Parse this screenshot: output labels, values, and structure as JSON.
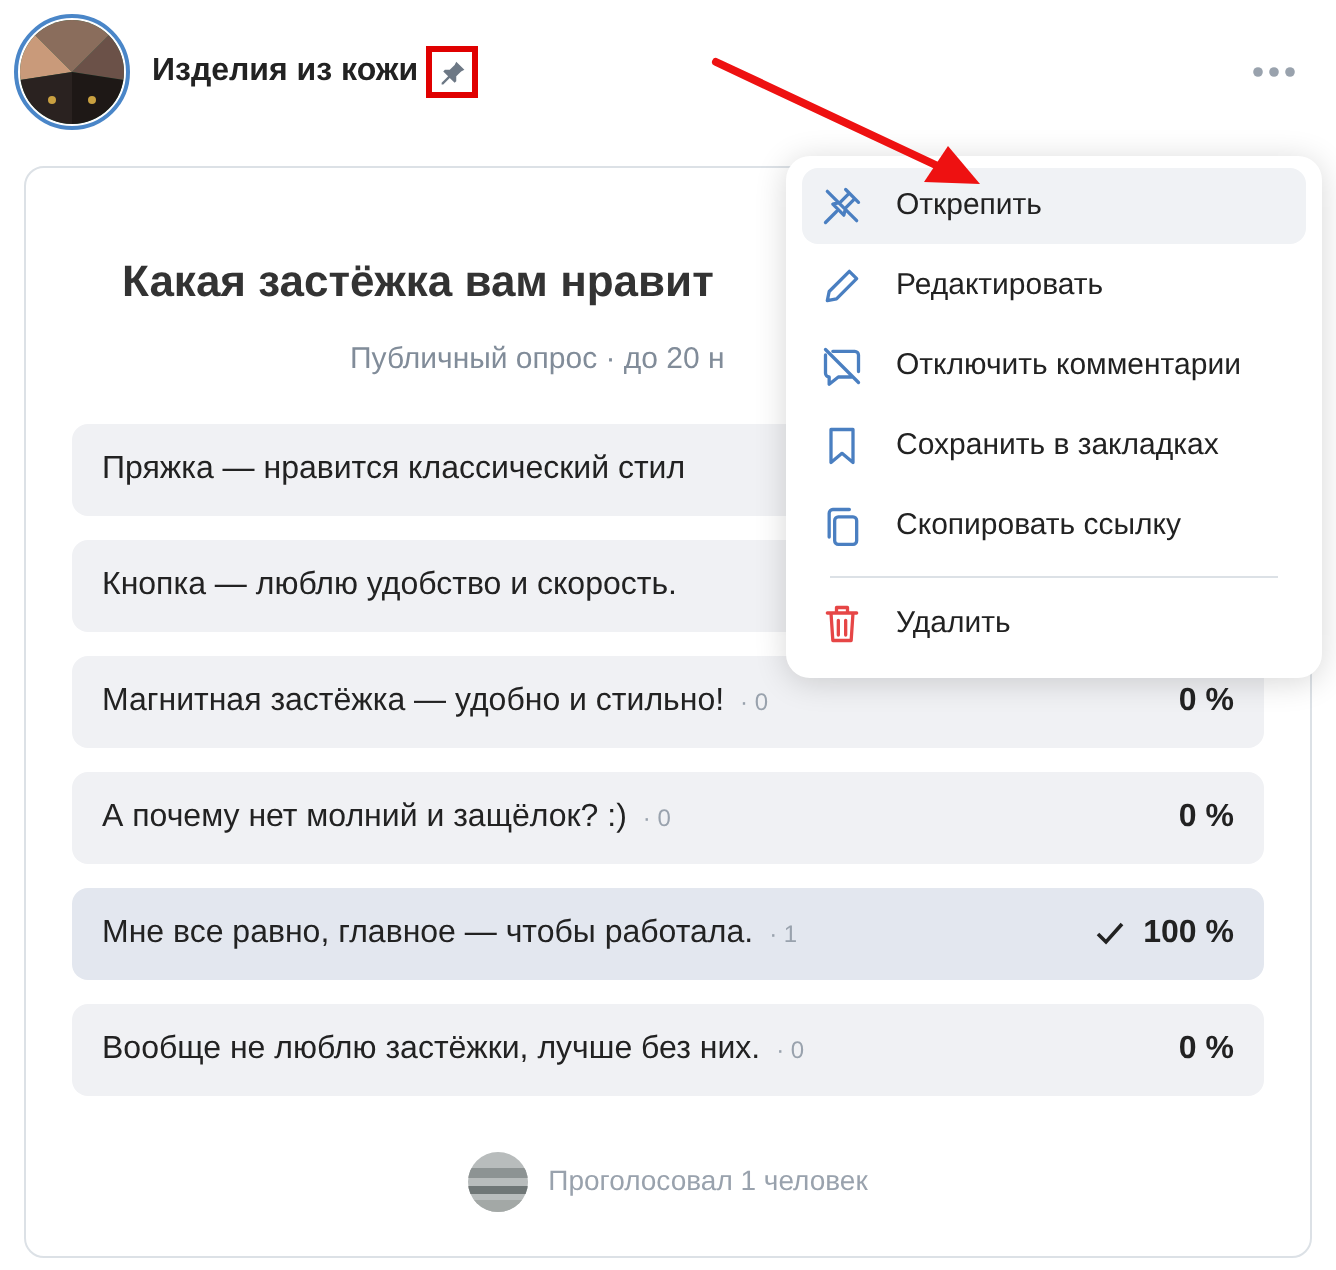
{
  "post": {
    "author": "Изделия из кожи",
    "pinned": true
  },
  "poll": {
    "title": "Какая застёжка вам нравит",
    "subtitle": "Публичный опрос · до 20 н",
    "options": [
      {
        "text": "Пряжка — нравится классический стил",
        "selected": false
      },
      {
        "text": "Кнопка — люблю удобство и скорость.",
        "selected": false
      },
      {
        "text": "Магнитная застёжка — удобно и стильно!",
        "count": "· 0",
        "percent": "0 %",
        "selected": false
      },
      {
        "text": "А почему нет молний и защёлок? :)",
        "count": "· 0",
        "percent": "0 %",
        "selected": false
      },
      {
        "text": "Мне все равно, главное — чтобы работала.",
        "count": "· 1",
        "percent": "100 %",
        "selected": true
      },
      {
        "text": "Вообще не люблю застёжки, лучше без них.",
        "count": "· 0",
        "percent": "0 %",
        "selected": false
      }
    ],
    "voters": "Проголосовал 1 человек"
  },
  "menu": {
    "items": [
      {
        "kind": "unpin",
        "label": "Открепить",
        "selected": true
      },
      {
        "kind": "edit",
        "label": "Редактировать",
        "selected": false
      },
      {
        "kind": "comments-off",
        "label": "Отключить комментарии",
        "selected": false
      },
      {
        "kind": "bookmark",
        "label": "Сохранить в закладках",
        "selected": false
      },
      {
        "kind": "copy",
        "label": "Скопировать ссылку",
        "selected": false
      },
      {
        "kind": "delete",
        "label": "Удалить",
        "selected": false
      }
    ]
  }
}
